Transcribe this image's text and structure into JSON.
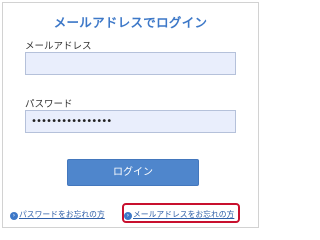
{
  "title": "メールアドレスでログイン",
  "email": {
    "label": "メールアドレス",
    "value": ""
  },
  "password": {
    "label": "パスワード",
    "value": "••••••••••••••••"
  },
  "login_button": "ログイン",
  "links": {
    "forgot_password": "パスワードをお忘れの方",
    "forgot_email": "メールアドレスをお忘れの方"
  },
  "highlight_color": "#c8102e",
  "accent_color": "#4f86cc",
  "icons": {
    "link_arrow": "chevron-right-icon"
  }
}
